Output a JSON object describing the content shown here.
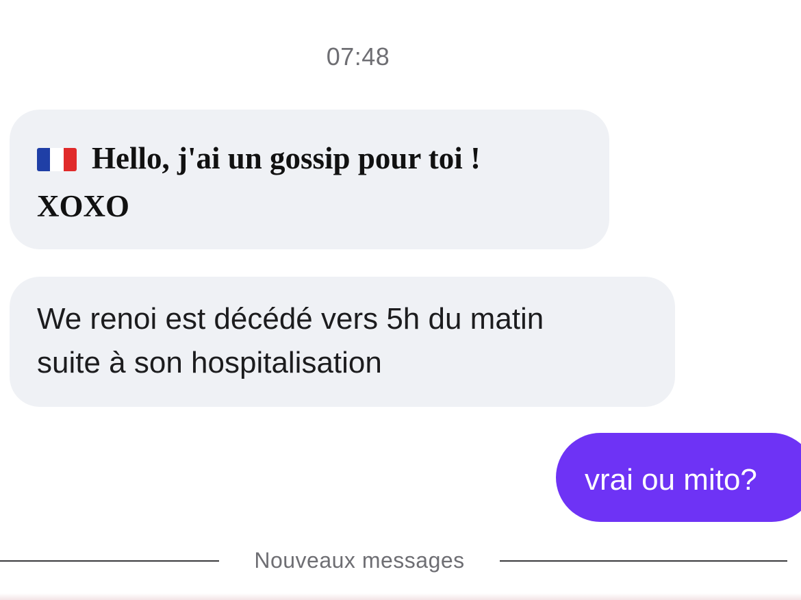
{
  "thread": {
    "timestamp": "07:48",
    "messages": [
      {
        "direction": "incoming",
        "flag_icon": "flag-france-icon",
        "lines": [
          "Hello, j'ai un gossip pour toi !",
          "XOXO"
        ]
      },
      {
        "direction": "incoming",
        "text": "We renoi est décédé vers 5h du matin\nsuite à son hospitalisation"
      },
      {
        "direction": "outgoing",
        "text": "vrai ou mito?"
      }
    ],
    "divider_label": "Nouveaux messages"
  },
  "colors": {
    "incoming_bubble": "#eff1f5",
    "outgoing_bubble": "#6e33f5",
    "flag_blue": "#1f3fa6",
    "flag_white": "#ffffff",
    "flag_red": "#e02a2a"
  }
}
